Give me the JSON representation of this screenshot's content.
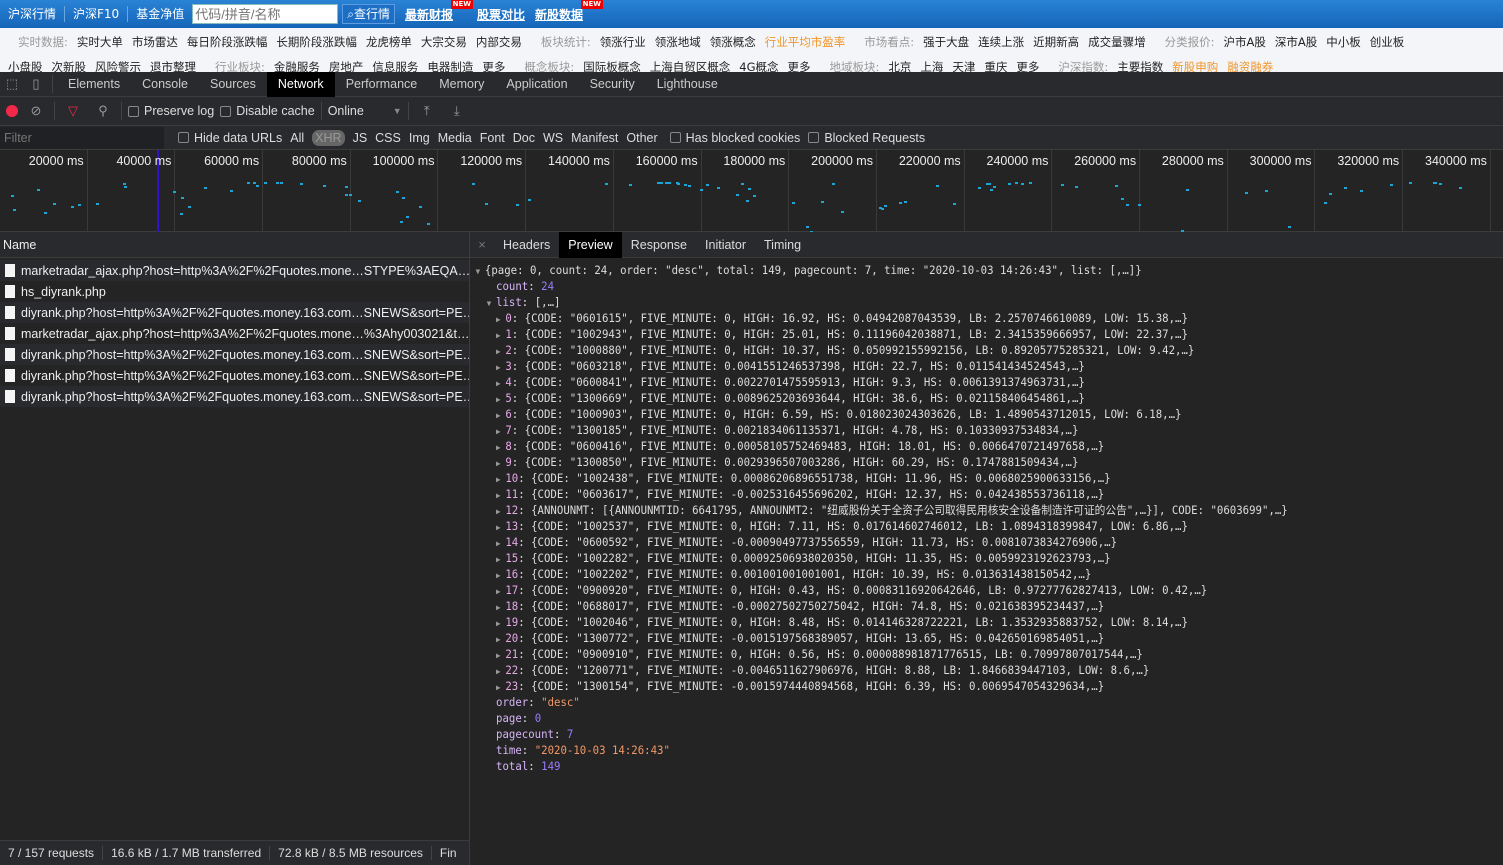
{
  "site": {
    "nav": [
      "沪深行情",
      "沪深F10",
      "基金净值"
    ],
    "search_placeholder": "代码/拼音/名称",
    "search_button": "查行情",
    "links": [
      {
        "label": "最新财报",
        "badge": "NEW"
      },
      {
        "label": "股票对比",
        "badge": ""
      },
      {
        "label": "新股数据",
        "badge": "NEW"
      }
    ],
    "row1": [
      {
        "t": "实时数据:",
        "k": "lbl"
      },
      {
        "t": "实时大单"
      },
      {
        "t": "市场雷达"
      },
      {
        "t": "每日阶段涨跌幅"
      },
      {
        "t": "长期阶段涨跌幅"
      },
      {
        "t": "龙虎榜单"
      },
      {
        "t": "大宗交易"
      },
      {
        "t": "内部交易"
      },
      {
        "t": "板块统计:",
        "k": "lbl"
      },
      {
        "t": "领涨行业"
      },
      {
        "t": "领涨地域"
      },
      {
        "t": "领涨概念"
      },
      {
        "t": "行业平均市盈率",
        "k": "hl"
      },
      {
        "t": "市场看点:",
        "k": "lbl"
      },
      {
        "t": "强于大盘"
      },
      {
        "t": "连续上涨"
      },
      {
        "t": "近期新高"
      },
      {
        "t": "成交量骤增"
      },
      {
        "t": "分类报价:",
        "k": "lbl"
      },
      {
        "t": "沪市A股"
      },
      {
        "t": "深市A股"
      },
      {
        "t": "中小板"
      },
      {
        "t": "创业板"
      }
    ],
    "row2": [
      {
        "t": "小盘股"
      },
      {
        "t": "次新股"
      },
      {
        "t": "风险警示"
      },
      {
        "t": "退市整理"
      },
      {
        "t": "行业板块:",
        "k": "lbl"
      },
      {
        "t": "金融服务"
      },
      {
        "t": "房地产"
      },
      {
        "t": "信息服务"
      },
      {
        "t": "电器制造"
      },
      {
        "t": "更多"
      },
      {
        "t": "概念板块:",
        "k": "lbl"
      },
      {
        "t": "国际板概念"
      },
      {
        "t": "上海自贸区概念"
      },
      {
        "t": "4G概念"
      },
      {
        "t": "更多"
      },
      {
        "t": "地域板块:",
        "k": "lbl"
      },
      {
        "t": "北京"
      },
      {
        "t": "上海"
      },
      {
        "t": "天津"
      },
      {
        "t": "重庆"
      },
      {
        "t": "更多"
      },
      {
        "t": "沪深指数:",
        "k": "lbl"
      },
      {
        "t": "主要指数"
      },
      {
        "t": "新股申购",
        "k": "hl"
      },
      {
        "t": "融资融券",
        "k": "hl"
      }
    ]
  },
  "devtools": {
    "tabs": [
      "Elements",
      "Console",
      "Sources",
      "Network",
      "Performance",
      "Memory",
      "Application",
      "Security",
      "Lighthouse"
    ],
    "active_tab": "Network",
    "toolbar": {
      "preserve_log": "Preserve log",
      "disable_cache": "Disable cache",
      "throttle": "Online"
    },
    "filter": {
      "placeholder": "Filter",
      "hide_data_urls": "Hide data URLs",
      "types": [
        "All",
        "XHR",
        "JS",
        "CSS",
        "Img",
        "Media",
        "Font",
        "Doc",
        "WS",
        "Manifest",
        "Other"
      ],
      "active_type": "XHR",
      "has_blocked_cookies": "Has blocked cookies",
      "blocked_requests": "Blocked Requests"
    },
    "timeline_ticks": [
      "20000 ms",
      "40000 ms",
      "60000 ms",
      "80000 ms",
      "100000 ms",
      "120000 ms",
      "140000 ms",
      "160000 ms",
      "180000 ms",
      "200000 ms",
      "220000 ms",
      "240000 ms",
      "260000 ms",
      "280000 ms",
      "300000 ms",
      "320000 ms",
      "340000 ms"
    ],
    "name_header": "Name",
    "requests": [
      "marketradar_ajax.php?host=http%3A%2F%2Fquotes.mone…STYPE%3AEQA…",
      "hs_diyrank.php",
      "diyrank.php?host=http%3A%2F%2Fquotes.money.163.com…SNEWS&sort=PE…",
      "marketradar_ajax.php?host=http%3A%2F%2Fquotes.mone…%3Ahy003021&t…",
      "diyrank.php?host=http%3A%2F%2Fquotes.money.163.com…SNEWS&sort=PE…",
      "diyrank.php?host=http%3A%2F%2Fquotes.money.163.com…SNEWS&sort=PE…",
      "diyrank.php?host=http%3A%2F%2Fquotes.money.163.com…SNEWS&sort=PE…"
    ],
    "status": [
      "7 / 157 requests",
      "16.6 kB / 1.7 MB transferred",
      "72.8 kB / 8.5 MB resources",
      "Fin"
    ],
    "detail_tabs": [
      "Headers",
      "Preview",
      "Response",
      "Initiator",
      "Timing"
    ],
    "active_detail_tab": "Preview",
    "preview": {
      "root": "{page: 0, count: 24, order: \"desc\", total: 149, pagecount: 7, time: \"2020-10-03 14:26:43\", list: [,…]}",
      "count": "24",
      "list_summary": "[,…]",
      "list": [
        "{CODE: \"0601615\", FIVE_MINUTE: 0, HIGH: 16.92, HS: 0.04942087043539, LB: 2.2570746610089, LOW: 15.38,…}",
        "{CODE: \"1002943\", FIVE_MINUTE: 0, HIGH: 25.01, HS: 0.11196042038871, LB: 2.3415359666957, LOW: 22.37,…}",
        "{CODE: \"1000880\", FIVE_MINUTE: 0, HIGH: 10.37, HS: 0.050992155992156, LB: 0.89205775285321, LOW: 9.42,…}",
        "{CODE: \"0603218\", FIVE_MINUTE: 0.0041551246537398, HIGH: 22.7, HS: 0.011541434524543,…}",
        "{CODE: \"0600841\", FIVE_MINUTE: 0.0022701475595913, HIGH: 9.3, HS: 0.0061391374963731,…}",
        "{CODE: \"1300669\", FIVE_MINUTE: 0.0089625203693644, HIGH: 38.6, HS: 0.021158406454861,…}",
        "{CODE: \"1000903\", FIVE_MINUTE: 0, HIGH: 6.59, HS: 0.018023024303626, LB: 1.4890543712015, LOW: 6.18,…}",
        "{CODE: \"1300185\", FIVE_MINUTE: 0.0021834061135371, HIGH: 4.78, HS: 0.10330937534834,…}",
        "{CODE: \"0600416\", FIVE_MINUTE: 0.00058105752469483, HIGH: 18.01, HS: 0.0066470721497658,…}",
        "{CODE: \"1300850\", FIVE_MINUTE: 0.0029396507003286, HIGH: 60.29, HS: 0.1747881509434,…}",
        "{CODE: \"1002438\", FIVE_MINUTE: 0.00086206896551738, HIGH: 11.96, HS: 0.0068025900633156,…}",
        "{CODE: \"0603617\", FIVE_MINUTE: -0.0025316455696202, HIGH: 12.37, HS: 0.042438553736118,…}",
        "{ANNOUNMT: [{ANNOUNMTID: 6641795, ANNOUNMT2: \"纽威股份关于全资子公司取得民用核安全设备制造许可证的公告\",…}], CODE: \"0603699\",…}",
        "{CODE: \"1002537\", FIVE_MINUTE: 0, HIGH: 7.11, HS: 0.017614602746012, LB: 1.0894318399847, LOW: 6.86,…}",
        "{CODE: \"0600592\", FIVE_MINUTE: -0.00090497737556559, HIGH: 11.73, HS: 0.0081073834276906,…}",
        "{CODE: \"1002282\", FIVE_MINUTE: 0.00092506938020350, HIGH: 11.35, HS: 0.0059923192623793,…}",
        "{CODE: \"1002202\", FIVE_MINUTE: 0.001001001001001, HIGH: 10.39, HS: 0.013631438150542,…}",
        "{CODE: \"0900920\", FIVE_MINUTE: 0, HIGH: 0.43, HS: 0.00083116920642646, LB: 0.97277762827413, LOW: 0.42,…}",
        "{CODE: \"0688017\", FIVE_MINUTE: -0.00027502750275042, HIGH: 74.8, HS: 0.021638395234437,…}",
        "{CODE: \"1002046\", FIVE_MINUTE: 0, HIGH: 8.48, HS: 0.014146328722221, LB: 1.3532935883752, LOW: 8.14,…}",
        "{CODE: \"1300772\", FIVE_MINUTE: -0.0015197568389057, HIGH: 13.65, HS: 0.042650169854051,…}",
        "{CODE: \"0900910\", FIVE_MINUTE: 0, HIGH: 0.56, HS: 0.000088981871776515, LB: 0.70997807017544,…}",
        "{CODE: \"1200771\", FIVE_MINUTE: -0.0046511627906976, HIGH: 8.88, LB: 1.8466839447103, LOW: 8.6,…}",
        "{CODE: \"1300154\", FIVE_MINUTE: -0.0015974440894568, HIGH: 6.39, HS: 0.0069547054329634,…}"
      ],
      "order": "\"desc\"",
      "page": "0",
      "pagecount": "7",
      "time": "\"2020-10-03 14:26:43\"",
      "total": "149"
    }
  },
  "colors": {
    "record": "#f2284b",
    "site_blue": "#1e73c6",
    "highlight": "#f0962a"
  }
}
